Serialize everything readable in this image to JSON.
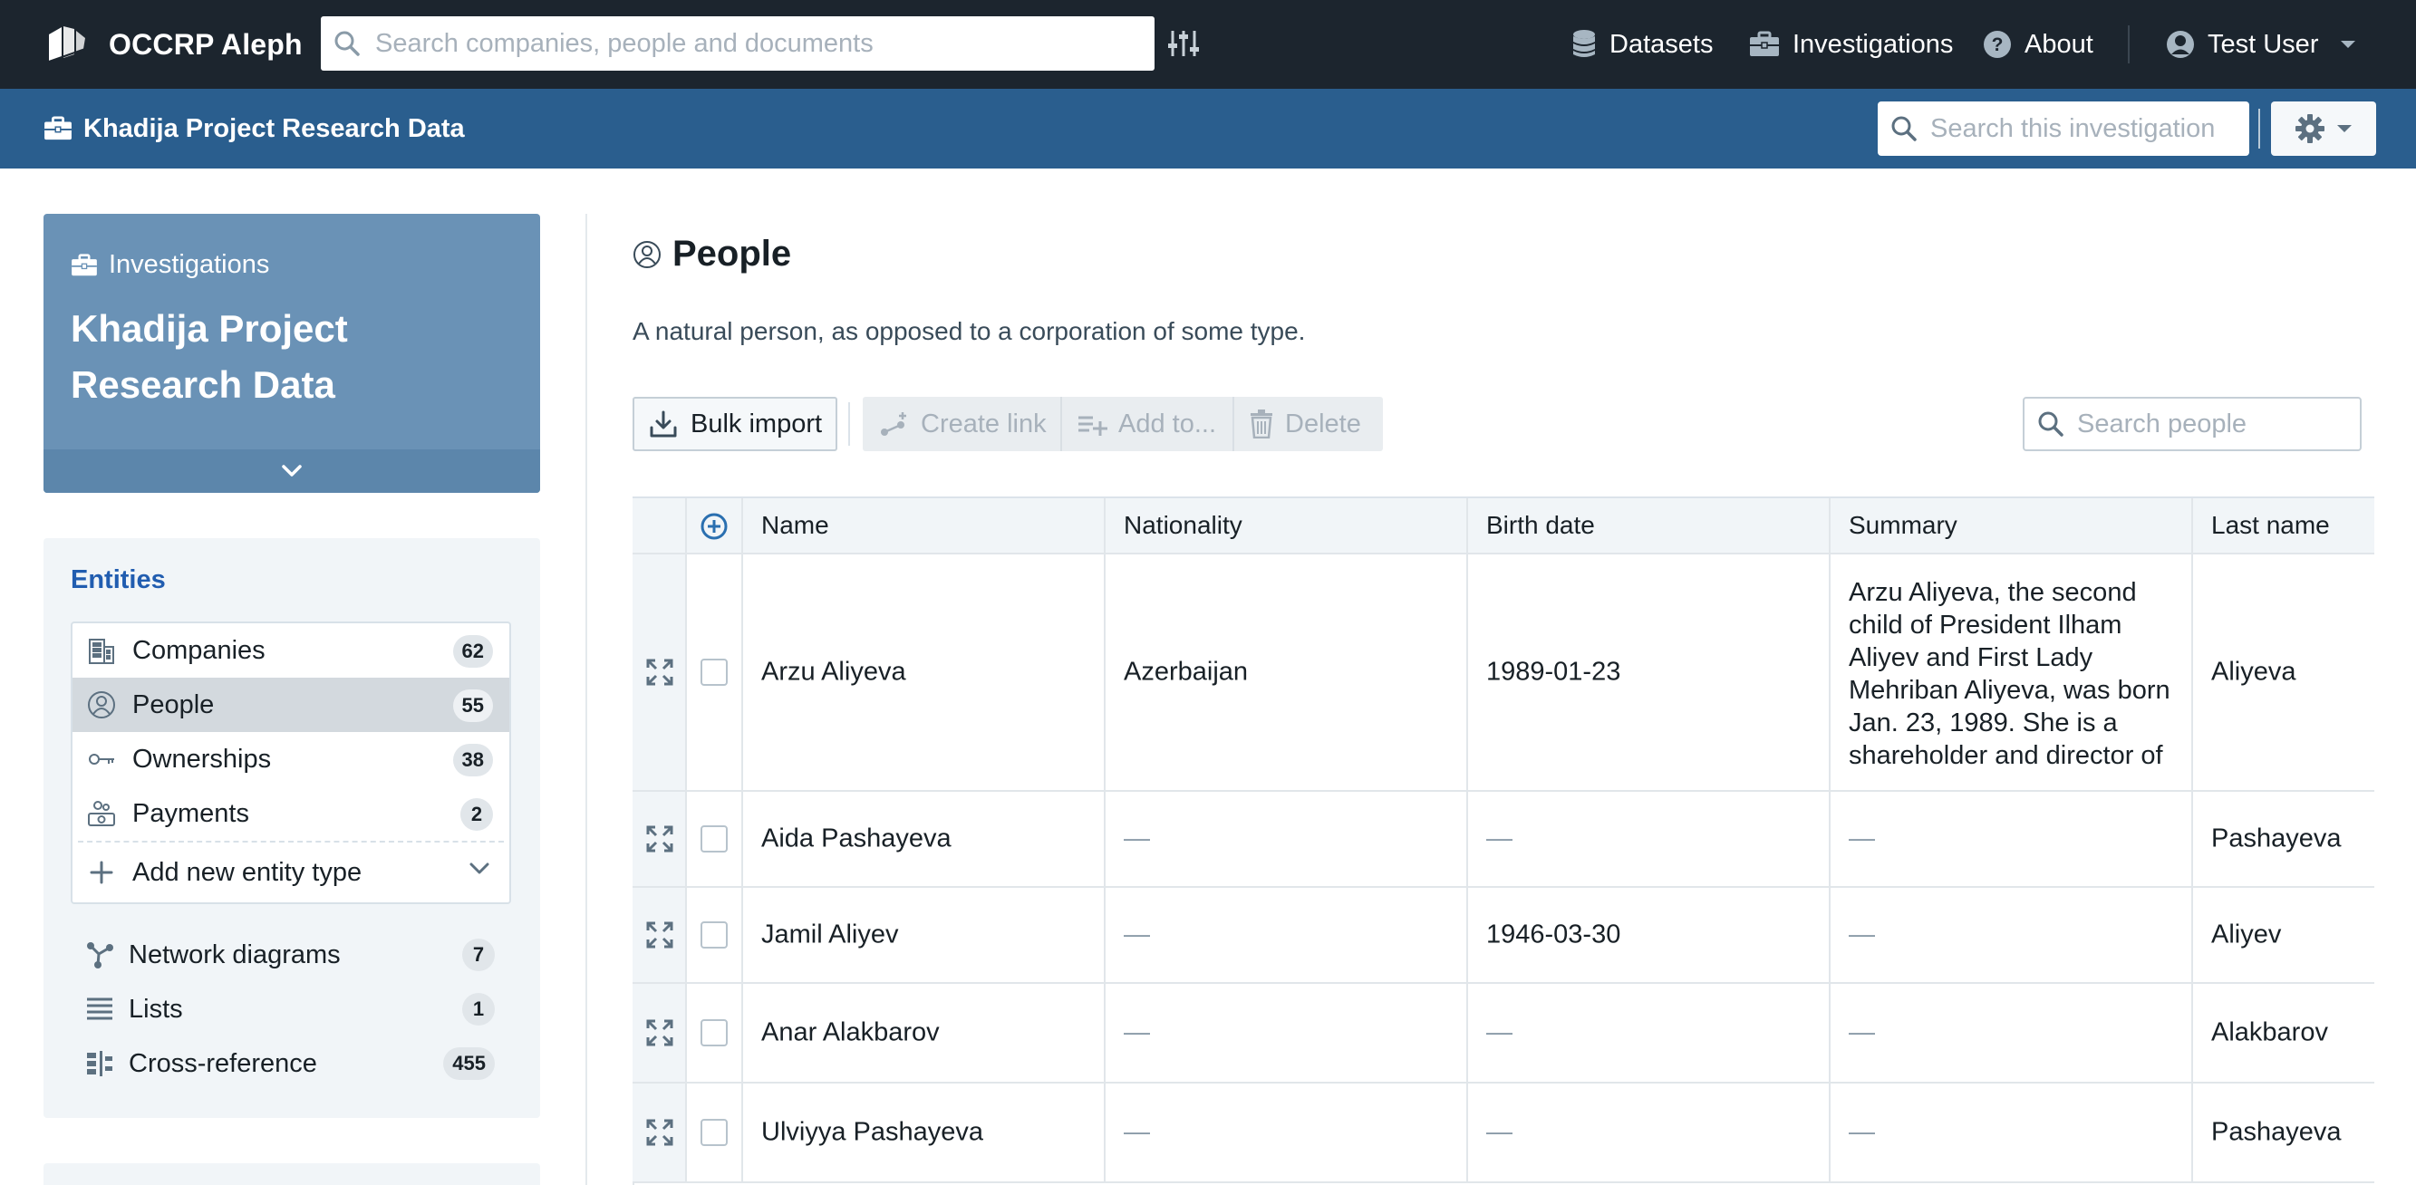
{
  "navbar": {
    "brand": "OCCRP Aleph",
    "search_placeholder": "Search companies, people and documents",
    "links": {
      "datasets": "Datasets",
      "investigations": "Investigations",
      "about": "About"
    },
    "user": "Test User"
  },
  "subheader": {
    "title": "Khadija Project Research Data",
    "search_placeholder": "Search this investigation"
  },
  "sidebar": {
    "card": {
      "kicker": "Investigations",
      "name": "Khadija Project Research Data"
    },
    "entities_title": "Entities",
    "schemata": [
      {
        "label": "Companies",
        "count": "62",
        "icon": "companies-icon"
      },
      {
        "label": "People",
        "count": "55",
        "icon": "person-icon"
      },
      {
        "label": "Ownerships",
        "count": "38",
        "icon": "key-icon"
      },
      {
        "label": "Payments",
        "count": "2",
        "icon": "payment-icon"
      }
    ],
    "add_type": "Add new entity type",
    "extras": [
      {
        "label": "Network diagrams",
        "count": "7"
      },
      {
        "label": "Lists",
        "count": "1"
      },
      {
        "label": "Cross-reference",
        "count": "455"
      }
    ]
  },
  "main": {
    "title": "People",
    "description": "A natural person, as opposed to a corporation of some type.",
    "toolbar": {
      "bulk_import": "Bulk import",
      "create_link": "Create link",
      "add_to": "Add to...",
      "delete": "Delete",
      "search_placeholder": "Search people"
    },
    "columns": [
      "Name",
      "Nationality",
      "Birth date",
      "Summary",
      "Last name"
    ],
    "rows": [
      {
        "name": "Arzu Aliyeva",
        "nationality": "Azerbaijan",
        "birth_date": "1989-01-23",
        "summary": "Arzu Aliyeva, the second child of President Ilham Aliyev and First Lady Mehriban Aliyeva, was born Jan. 23, 1989. She is a shareholder and director of",
        "last_name": "Aliyeva"
      },
      {
        "name": "Aida Pashayeva",
        "nationality": "—",
        "birth_date": "—",
        "summary": "—",
        "last_name": "Pashayeva"
      },
      {
        "name": "Jamil Aliyev",
        "nationality": "—",
        "birth_date": "1946-03-30",
        "summary": "—",
        "last_name": "Aliyev"
      },
      {
        "name": "Anar Alakbarov",
        "nationality": "—",
        "birth_date": "—",
        "summary": "—",
        "last_name": "Alakbarov"
      },
      {
        "name": "Ulviyya Pashayeva",
        "nationality": "—",
        "birth_date": "—",
        "summary": "—",
        "last_name": "Pashayeva"
      }
    ]
  }
}
